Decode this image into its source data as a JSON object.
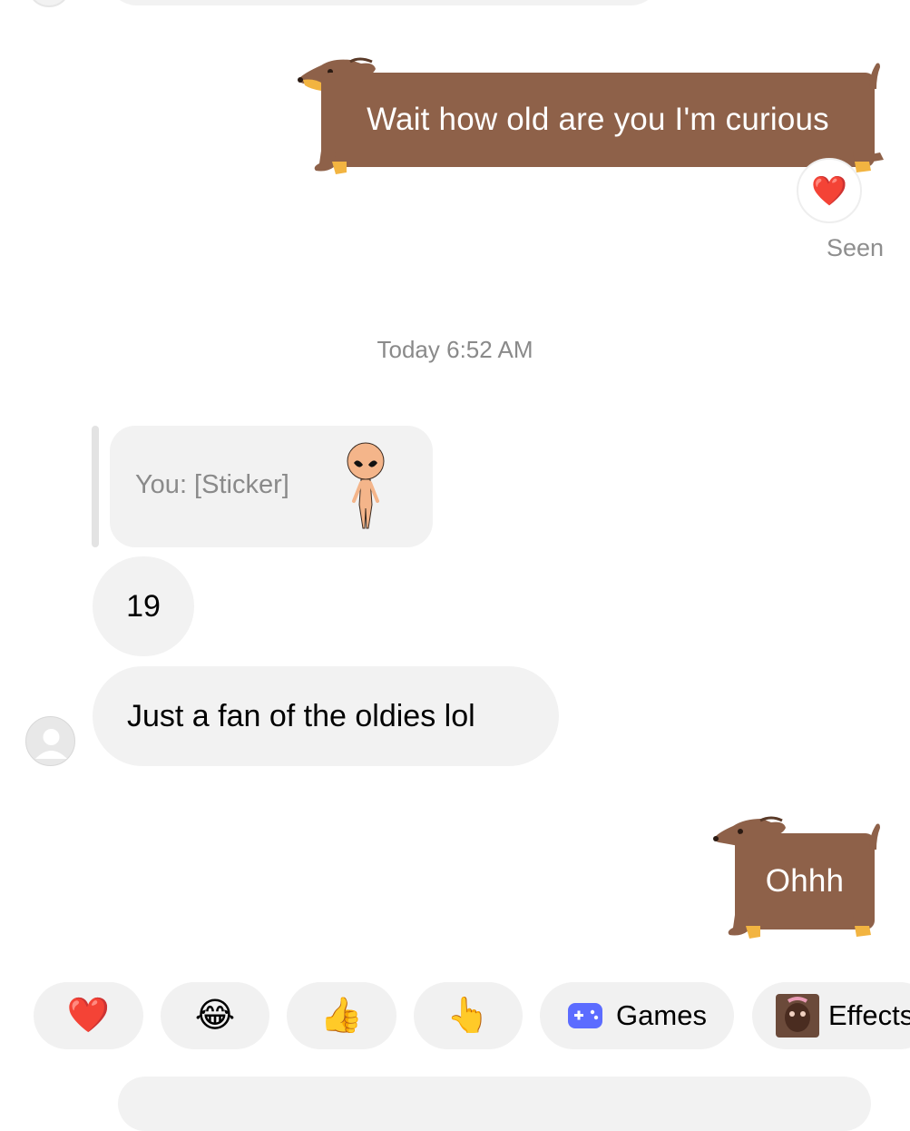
{
  "messages": {
    "outgoing_1": "Wait how old are you I'm curious",
    "reaction_emoji": "❤️",
    "seen_label": "Seen",
    "timestamp": "Today 6:52 AM",
    "reply_quote": "You: [Sticker]",
    "incoming_1": "19",
    "incoming_2": "Just a fan of the oldies lol",
    "outgoing_2": "Ohhh"
  },
  "quick_reactions": [
    {
      "emoji": "❤️"
    },
    {
      "emoji": "😂"
    },
    {
      "emoji": "👍"
    },
    {
      "emoji": "👆"
    }
  ],
  "games_chip": {
    "label": "Games",
    "icon": "gamepad-icon"
  },
  "effects_chip": {
    "label": "Effects",
    "icon": "effects-thumbnail"
  },
  "colors": {
    "dog_bubble": "#8e6149",
    "incoming_bubble": "#f2f2f2",
    "games_icon": "#5c6cff"
  }
}
